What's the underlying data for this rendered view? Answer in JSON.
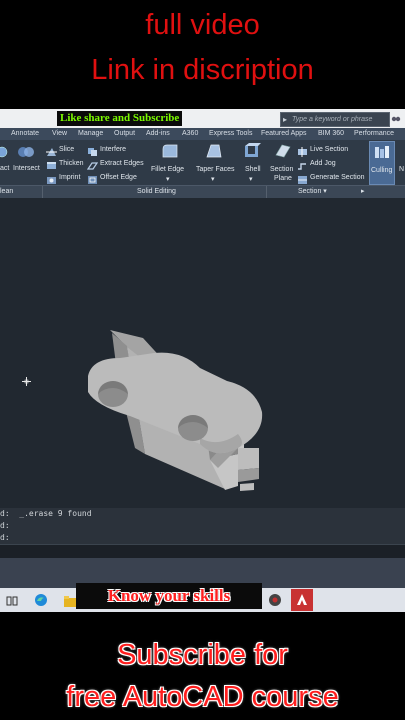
{
  "overlay": {
    "top_line1": "full video",
    "top_line2": "Link in discription",
    "promo_banner": "Like share and Subscribe",
    "skills_banner": "Know your skills",
    "bottom_line1": "Subscribe for",
    "bottom_line2": "free AutoCAD course"
  },
  "search": {
    "placeholder": "Type a keyword or phrase"
  },
  "ribbon_tabs": [
    "Annotate",
    "View",
    "Manage",
    "Output",
    "Add-ins",
    "A360",
    "Express Tools",
    "Featured Apps",
    "BIM 360",
    "Performance"
  ],
  "ribbon": {
    "left_cut1": "act",
    "intersect": "Intersect",
    "slice": "Slice",
    "thicken": "Thicken",
    "imprint": "Imprint",
    "interfere": "Interfere",
    "extract_edges": "Extract Edges",
    "offset_edge": "Offset Edge",
    "fillet_edge": "Fillet Edge",
    "taper_faces": "Taper Faces",
    "shell": "Shell",
    "section_plane_1": "Section",
    "section_plane_2": "Plane",
    "live_section": "Live Section",
    "add_jog": "Add Jog",
    "generate_section": "Generate Section",
    "culling": "Culling",
    "right_cut": "N"
  },
  "panels": {
    "clean": "lean",
    "solid_editing": "Solid Editing",
    "section": "Section ▾"
  },
  "command": {
    "line1": "d:  _.erase 9 found",
    "line2": "d:",
    "line3": "d:"
  },
  "colors": {
    "caption_red": "#e01010",
    "banner_green": "#7cfc00",
    "viewport_bg": "#212830",
    "model_gray": "#b4b4b4"
  }
}
